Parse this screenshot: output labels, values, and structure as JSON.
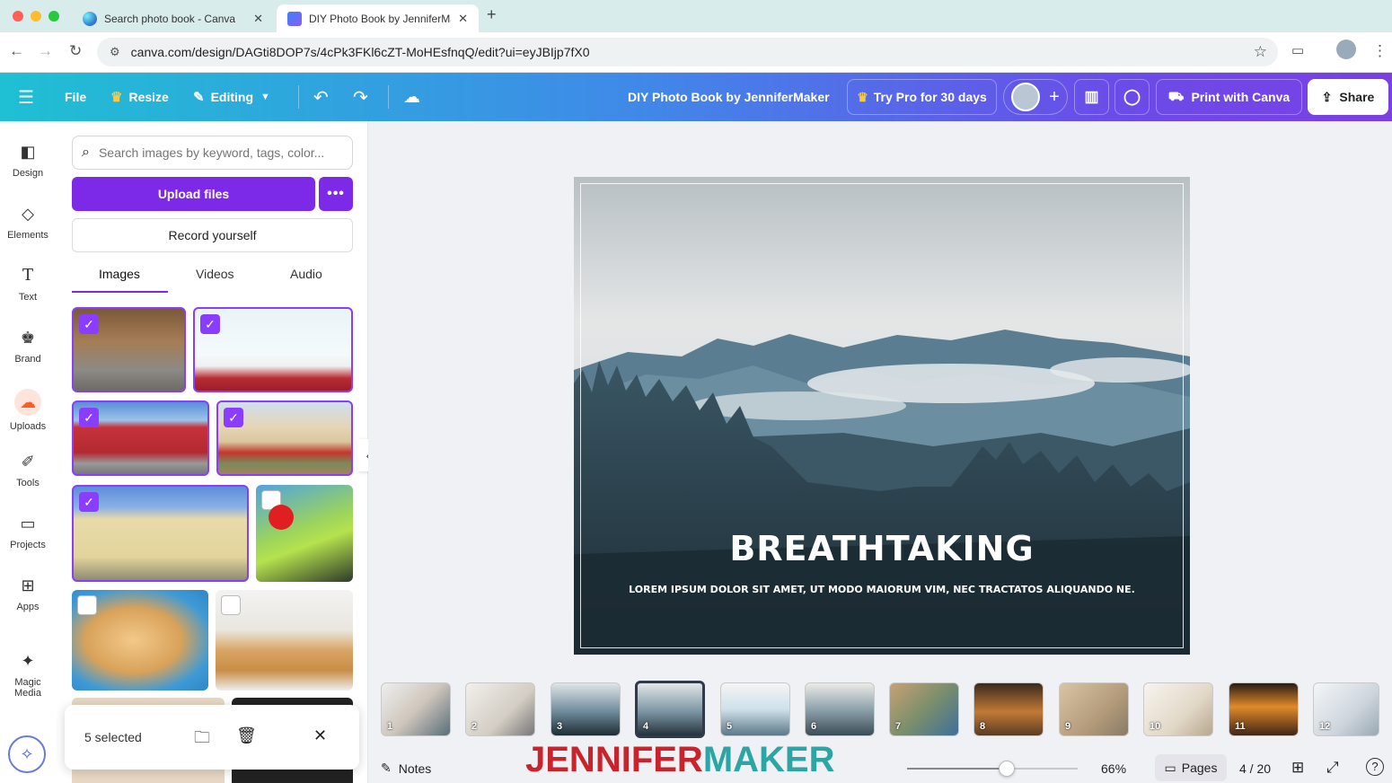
{
  "browser": {
    "tabs": [
      {
        "title": "Search photo book - Canva",
        "active": false
      },
      {
        "title": "DIY Photo Book by JenniferMaker",
        "active": true
      }
    ],
    "url": "canva.com/design/DAGti8DOP7s/4cPk3FKl6cZT-MoHEsfnqQ/edit?ui=eyJBIjp7fX0"
  },
  "topbar": {
    "file": "File",
    "resize": "Resize",
    "editing": "Editing",
    "doc_title": "DIY Photo Book by JenniferMaker",
    "try_pro": "Try Pro for 30 days",
    "print": "Print with Canva",
    "share": "Share"
  },
  "rail": [
    {
      "label": "Design",
      "icon": "design-icon"
    },
    {
      "label": "Elements",
      "icon": "elements-icon"
    },
    {
      "label": "Text",
      "icon": "text-icon"
    },
    {
      "label": "Brand",
      "icon": "brand-icon"
    },
    {
      "label": "Uploads",
      "icon": "uploads-icon"
    },
    {
      "label": "Tools",
      "icon": "tools-icon"
    },
    {
      "label": "Projects",
      "icon": "projects-icon"
    },
    {
      "label": "Apps",
      "icon": "apps-icon"
    },
    {
      "label": "Magic Media",
      "icon": "magic-media-icon"
    }
  ],
  "panel": {
    "search_placeholder": "Search images by keyword, tags, color...",
    "upload": "Upload files",
    "more": "•••",
    "record": "Record yourself",
    "tabs": [
      "Images",
      "Videos",
      "Audio"
    ],
    "selection": {
      "count_label": "5 selected"
    }
  },
  "canvas": {
    "headline": "BREATHTAKING",
    "subline": "LOREM IPSUM DOLOR SIT AMET, UT MODO MAIORUM VIM, NEC TRACTATOS ALIQUANDO NE."
  },
  "pages": [
    "1",
    "2",
    "3",
    "4",
    "5",
    "6",
    "7",
    "8",
    "9",
    "10",
    "11",
    "12"
  ],
  "active_page": 4,
  "footer": {
    "notes": "Notes",
    "zoom": "66%",
    "zoom_fraction": 0.66,
    "pages_label": "Pages",
    "page_count": "4 / 20"
  },
  "watermark": {
    "part1": "JENNIFER",
    "part2": "MAKER"
  },
  "colors": {
    "accent": "#7d2ae8",
    "watermark_red": "#c9242b",
    "watermark_teal": "#2ca6a4"
  }
}
